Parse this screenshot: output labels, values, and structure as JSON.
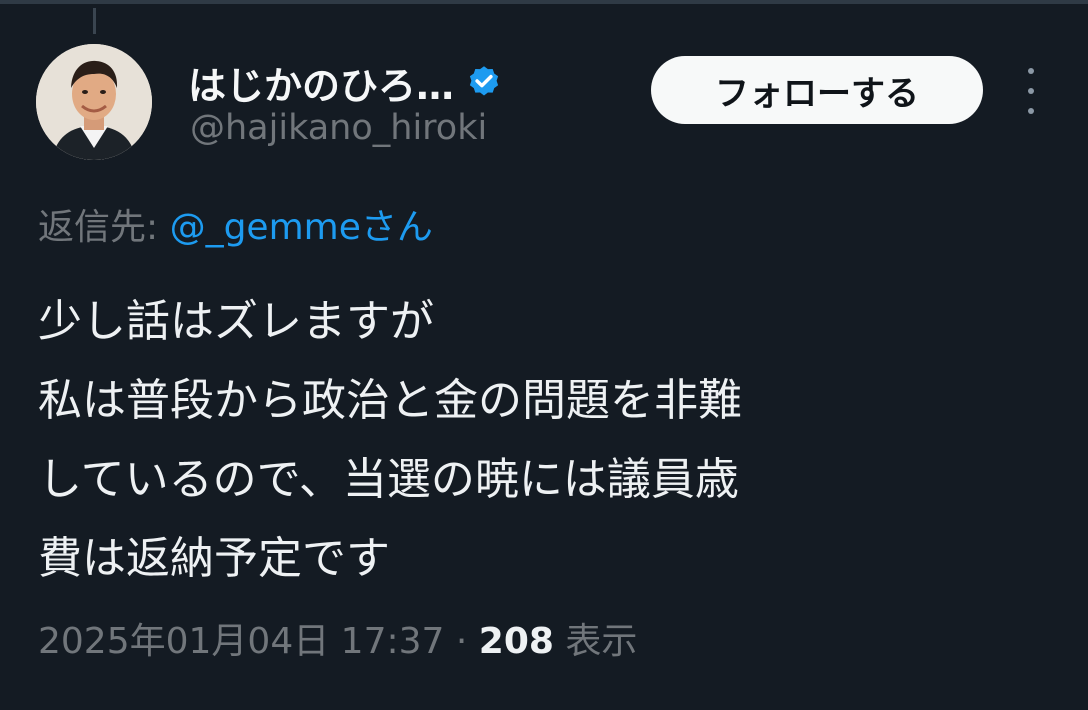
{
  "tweet": {
    "display_name": "はじかのひろ…",
    "handle": "@hajikano_hiroki",
    "follow_label": "フォローする",
    "reply_prefix": "返信先: ",
    "reply_mention": "@_gemmeさん",
    "text_lines": [
      "少し話はズレますが",
      "私は普段から政治と金の問題を非難",
      "しているので、当選の暁には議員歳",
      "費は返納予定です"
    ],
    "timestamp": "2025年01月04日 17:37",
    "separator": " · ",
    "views_count": "208",
    "views_label": " 表示"
  },
  "icons": {
    "avatar": "profile-photo",
    "verified": "verified-badge-icon",
    "more": "more-options-icon"
  },
  "colors": {
    "background": "#141b23",
    "accent_blue": "#1d9bf0",
    "verified_blue": "#1d9bf0",
    "secondary_text": "#71767b",
    "primary_text": "#eef1f3",
    "follow_button_bg": "#f7f9f9"
  }
}
